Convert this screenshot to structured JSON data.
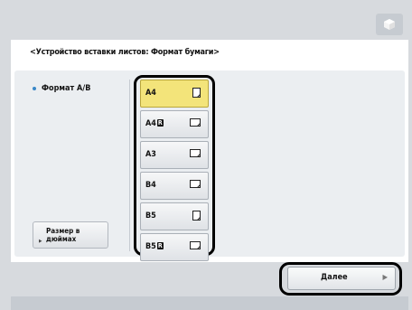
{
  "header": {
    "title": "<Устройство вставки листов: Формат бумаги>"
  },
  "left": {
    "format_label": "Формат A/B",
    "inch_button_label": "Размер в дюймах"
  },
  "sizes": [
    {
      "label": "A4",
      "badge": "",
      "orientation": "portrait",
      "selected": true
    },
    {
      "label": "A4",
      "badge": "R",
      "orientation": "landscape",
      "selected": false
    },
    {
      "label": "A3",
      "badge": "",
      "orientation": "landscape",
      "selected": false
    },
    {
      "label": "B4",
      "badge": "",
      "orientation": "landscape",
      "selected": false
    },
    {
      "label": "B5",
      "badge": "",
      "orientation": "portrait",
      "selected": false
    },
    {
      "label": "B5",
      "badge": "R",
      "orientation": "landscape",
      "selected": false
    }
  ],
  "footer": {
    "next_label": "Далее"
  },
  "colors": {
    "selected": "#f3e47a",
    "accent": "#3a88c8"
  },
  "icons": {
    "top_right": "cube-icon",
    "inch_indicator": "triangle-right-icon",
    "next": "arrow-right-icon"
  }
}
